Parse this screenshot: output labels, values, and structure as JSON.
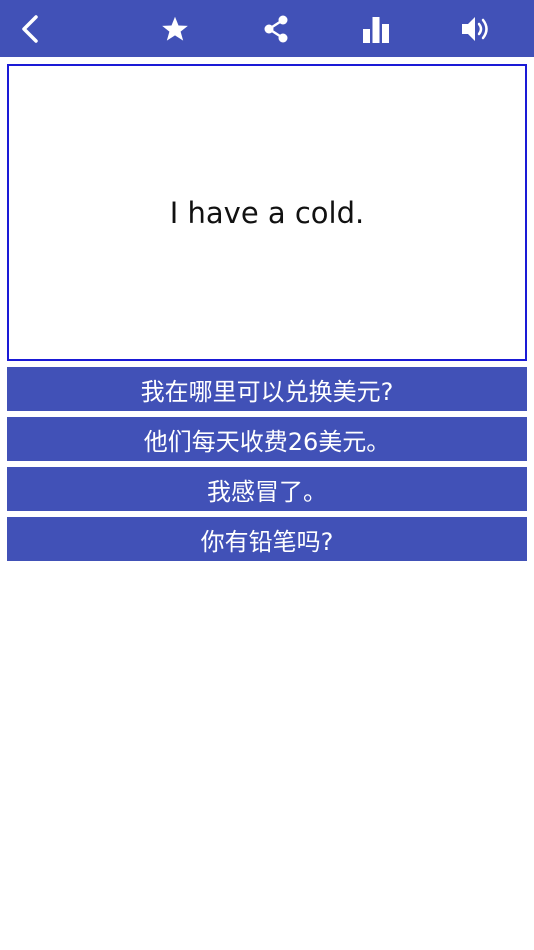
{
  "toolbar": {
    "background": "#4151b7",
    "icons": [
      "back-chevron-icon",
      "star-icon",
      "share-icon",
      "bar-chart-icon",
      "speaker-icon"
    ]
  },
  "card": {
    "prompt": "I have a cold.",
    "border_color": "#1a1ad6"
  },
  "answers": [
    {
      "label": "我在哪里可以兑换美元?"
    },
    {
      "label": "他们每天收费26美元。"
    },
    {
      "label": "我感冒了。"
    },
    {
      "label": "你有铅笔吗?"
    }
  ]
}
